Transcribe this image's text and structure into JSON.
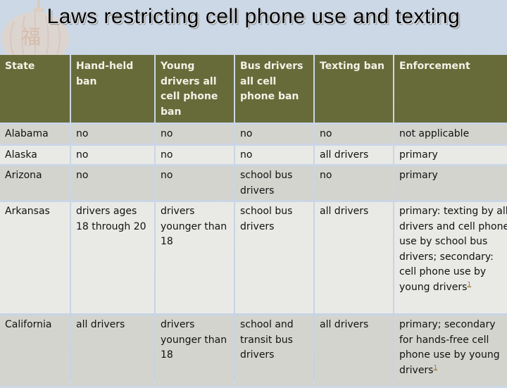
{
  "slide": {
    "title": "Laws restricting cell phone use and texting"
  },
  "table": {
    "headers": [
      "State",
      "Hand-held ban",
      "Young drivers all cell phone ban",
      "Bus drivers all cell phone ban",
      "Texting ban",
      "Enforcement"
    ],
    "rows": [
      {
        "state": "Alabama",
        "hand_held": "no",
        "young": "no",
        "bus": "no",
        "texting": "no",
        "enforcement": "not applicable",
        "footnote": ""
      },
      {
        "state": "Alaska",
        "hand_held": "no",
        "young": "no",
        "bus": "no",
        "texting": "all drivers",
        "enforcement": "primary",
        "footnote": ""
      },
      {
        "state": "Arizona",
        "hand_held": "no",
        "young": "no",
        "bus": "school bus drivers",
        "texting": "no",
        "enforcement": "primary",
        "footnote": ""
      },
      {
        "state": "Arkansas",
        "hand_held": "drivers ages 18 through 20",
        "young": "drivers younger than 18",
        "bus": "school bus drivers",
        "texting": "all drivers",
        "enforcement": "primary: texting by all drivers and cell phone use by school bus drivers; secondary: cell phone use by young drivers",
        "footnote": "1"
      },
      {
        "state": "California",
        "hand_held": "all drivers",
        "young": "drivers younger than 18",
        "bus": "school and transit bus drivers",
        "texting": "all drivers",
        "enforcement": "primary; secondary for hands-free cell phone use by young drivers",
        "footnote": "1"
      }
    ]
  },
  "decoration": {
    "background_icon": "lantern-icon"
  },
  "colors": {
    "header_bg": "#676b3a",
    "row_dark": "#d4d4cf",
    "row_light": "#e9e9e6",
    "footnote_link": "#9a7a2c"
  }
}
